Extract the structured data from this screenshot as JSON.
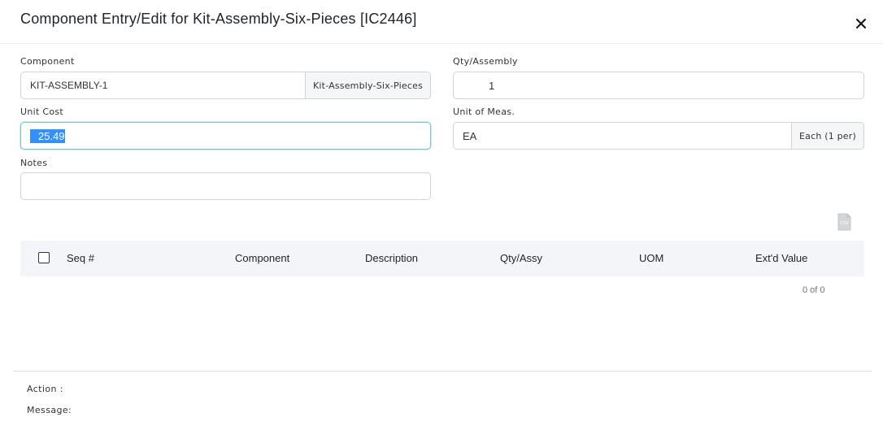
{
  "dialog": {
    "title": "Component Entry/Edit for Kit-Assembly-Six-Pieces [IC2446]",
    "close_icon": "close-icon"
  },
  "form": {
    "component": {
      "label": "Component",
      "value": "KIT-ASSEMBLY-1",
      "addon": "Kit-Assembly-Six-Pieces"
    },
    "qty_assembly": {
      "label": "Qty/Assembly",
      "value": "1"
    },
    "unit_cost": {
      "label": "Unit Cost",
      "value": "25.49"
    },
    "unit_of_meas": {
      "label": "Unit of Meas.",
      "value": "EA",
      "addon": "Each (1 per)"
    },
    "notes": {
      "label": "Notes",
      "value": ""
    }
  },
  "toolbar": {
    "csv_icon": "csv-export-icon",
    "csv_text": "CSV"
  },
  "table": {
    "columns": [
      "Seq #",
      "Component",
      "Description",
      "Qty/Assy",
      "UOM",
      "Ext'd Value"
    ],
    "rows": [],
    "pager": "0 of 0"
  },
  "footer": {
    "action_label": "Action :",
    "message_label": "Message:"
  },
  "colors": {
    "focus_border": "#7cc4d6",
    "selection": "#3390ff",
    "header_bg": "#f3f5f8"
  }
}
